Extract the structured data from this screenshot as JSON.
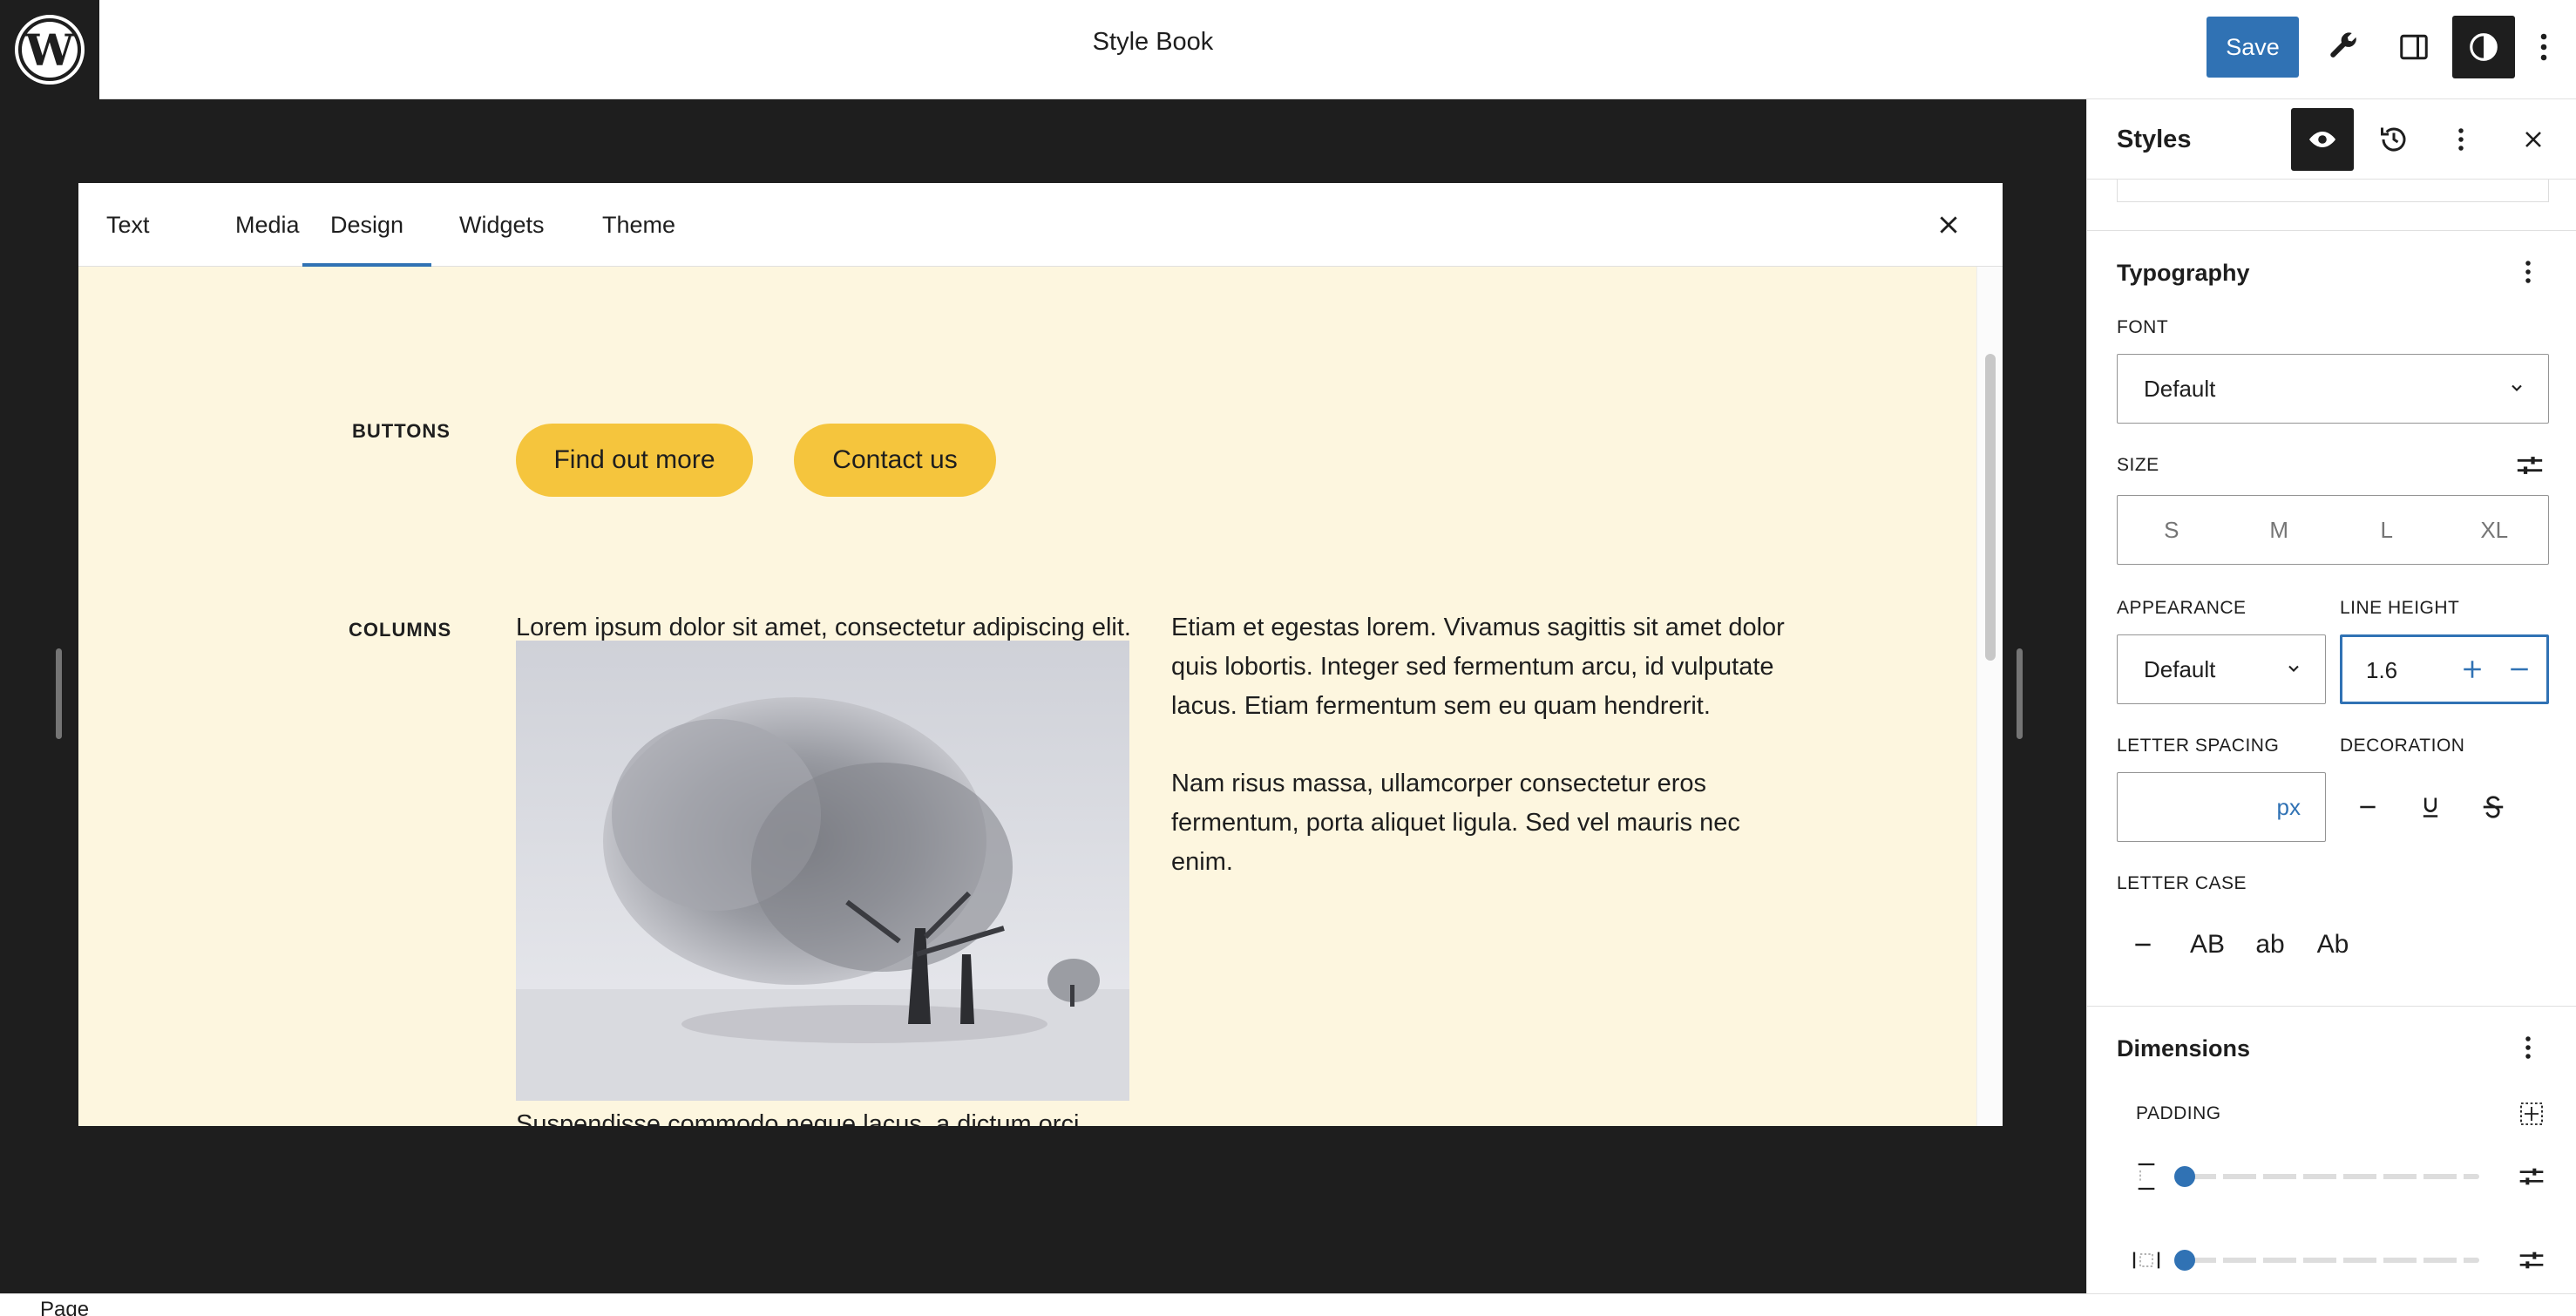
{
  "topbar": {
    "title": "Style Book",
    "save_label": "Save"
  },
  "stylebook": {
    "tabs": [
      {
        "label": "Text"
      },
      {
        "label": "Media"
      },
      {
        "label": "Design",
        "active": true
      },
      {
        "label": "Widgets"
      },
      {
        "label": "Theme"
      }
    ],
    "sections": {
      "buttons": {
        "label": "BUTTONS",
        "items": [
          "Find out more",
          "Contact us"
        ]
      },
      "columns": {
        "label": "COLUMNS",
        "col1_text": "Lorem ipsum dolor sit amet, consectetur adipiscing elit. Praesent et eros eu felis.",
        "col1_caption": "Suspendisse commodo neque lacus, a dictum orci interdum et.",
        "col2_para1": "Etiam et egestas lorem. Vivamus sagittis sit amet dolor quis lobortis. Integer sed fermentum arcu, id vulputate lacus. Etiam fermentum sem eu quam hendrerit.",
        "col2_para2": "Nam risus massa, ullamcorper consectetur eros fermentum, porta aliquet ligula. Sed vel mauris nec enim."
      }
    }
  },
  "sidebar": {
    "title": "Styles",
    "typography": {
      "title": "Typography",
      "font_label": "FONT",
      "font_value": "Default",
      "size_label": "SIZE",
      "sizes": [
        "S",
        "M",
        "L",
        "XL"
      ],
      "appearance_label": "APPEARANCE",
      "appearance_value": "Default",
      "line_height_label": "LINE HEIGHT",
      "line_height_value": "1.6",
      "letter_spacing_label": "LETTER SPACING",
      "letter_spacing_unit": "px",
      "decoration_label": "DECORATION",
      "letter_case_label": "LETTER CASE",
      "letter_cases": [
        "AB",
        "ab",
        "Ab"
      ]
    },
    "dimensions": {
      "title": "Dimensions",
      "padding_label": "PADDING"
    }
  },
  "footer": {
    "breadcrumb": "Page"
  },
  "colors": {
    "accent": "#3072b4",
    "button_bg": "#f5c53d",
    "stylebook_bg": "#fdf6df",
    "dark": "#1e1e1e"
  }
}
